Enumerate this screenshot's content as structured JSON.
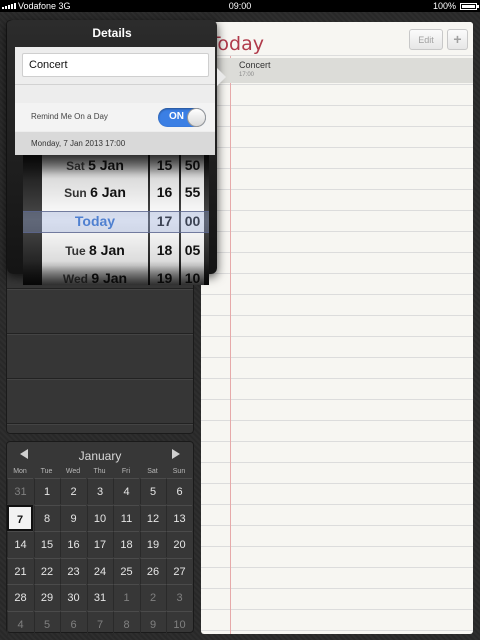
{
  "status_bar": {
    "carrier": "Vodafone 3G",
    "time": "09:00",
    "battery": "100%"
  },
  "notepad": {
    "title": "Today",
    "edit_label": "Edit",
    "add_label": "+",
    "reminder": {
      "name": "Concert",
      "time": "17:00"
    }
  },
  "popover": {
    "title": "Details",
    "name_value": "Concert",
    "remind_label": "Remind Me On a Day",
    "toggle_label": "ON",
    "date_value": "Monday, 7 Jan 2013 17:00",
    "picker": {
      "days": [
        {
          "name": "Sat",
          "day": "5 Jan"
        },
        {
          "name": "Sun",
          "day": "6 Jan"
        },
        {
          "name": "",
          "day": "Today"
        },
        {
          "name": "Tue",
          "day": "8 Jan"
        },
        {
          "name": "Wed",
          "day": "9 Jan"
        }
      ],
      "hours": [
        "15",
        "16",
        "17",
        "18",
        "19"
      ],
      "minutes": [
        "50",
        "55",
        "00",
        "05",
        "10"
      ],
      "selected_index": 2
    }
  },
  "mini_calendar": {
    "month": "January",
    "weekdays": [
      "Mon",
      "Tue",
      "Wed",
      "Thu",
      "Fri",
      "Sat",
      "Sun"
    ],
    "weeks": [
      [
        "31",
        "1",
        "2",
        "3",
        "4",
        "5",
        "6"
      ],
      [
        "7",
        "8",
        "9",
        "10",
        "11",
        "12",
        "13"
      ],
      [
        "14",
        "15",
        "16",
        "17",
        "18",
        "19",
        "20"
      ],
      [
        "21",
        "22",
        "23",
        "24",
        "25",
        "26",
        "27"
      ],
      [
        "28",
        "29",
        "30",
        "31",
        "1",
        "2",
        "3"
      ],
      [
        "4",
        "5",
        "6",
        "7",
        "8",
        "9",
        "10"
      ]
    ],
    "today": "7",
    "colors": {
      "accent": "#b03a4a",
      "picker_selected": "#2f6fd0",
      "toggle_on": "#3b7fe4"
    }
  }
}
